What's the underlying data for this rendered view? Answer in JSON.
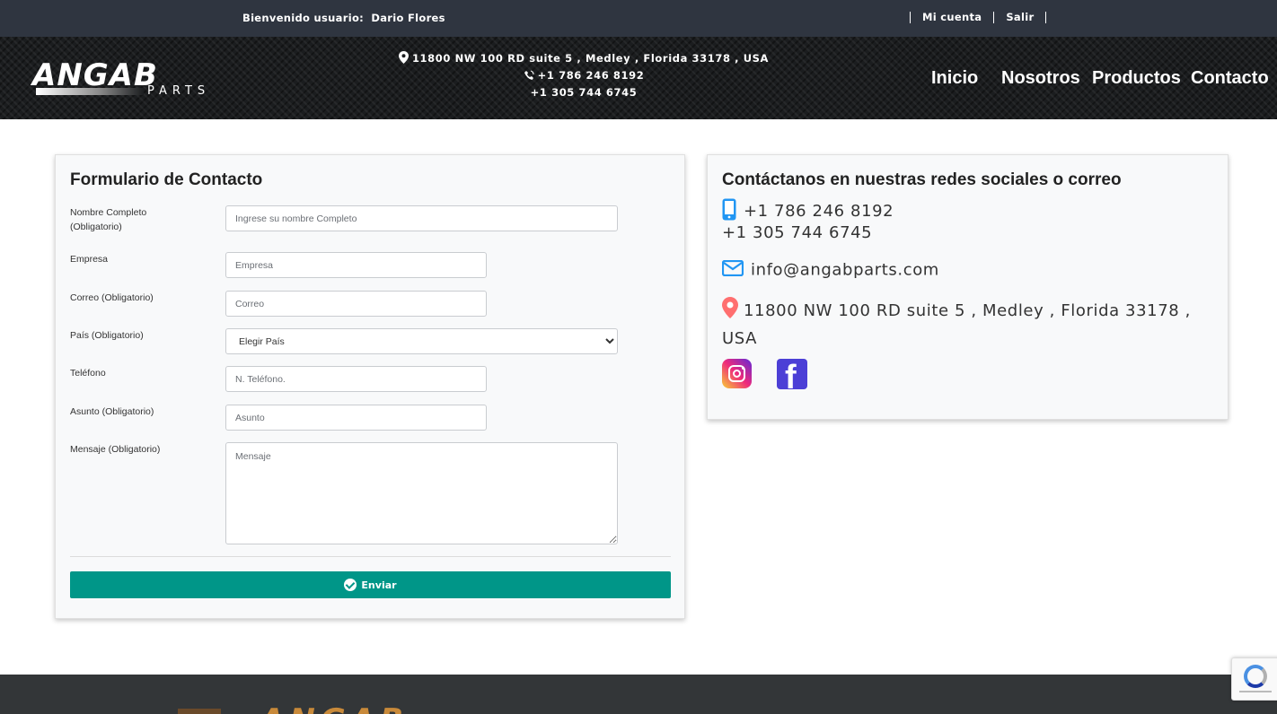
{
  "topbar": {
    "welcome_label": "Bienvenido usuario:",
    "user_name": "Dario Flores",
    "my_account": "Mi cuenta",
    "logout": "Salir"
  },
  "brand": {
    "logo_main": "ANGAB",
    "logo_sub": "PARTS"
  },
  "header_contact": {
    "address": "11800 NW 100 RD suite 5 , Medley , Florida 33178 , USA",
    "phone1": "+1 786 246 8192",
    "phone2": "+1 305 744 6745"
  },
  "nav": {
    "items": [
      "Inicio",
      "Nosotros",
      "Productos",
      "Contacto"
    ]
  },
  "form": {
    "title": "Formulario de Contacto",
    "fields": {
      "name_label": "Nombre Completo (Obligatorio)",
      "name_placeholder": "Ingrese su nombre Completo",
      "company_label": "Empresa",
      "company_placeholder": "Empresa",
      "email_label": "Correo (Obligatorio)",
      "email_placeholder": "Correo",
      "country_label": "País (Obligatorio)",
      "country_selected": "Elegir País",
      "phone_label": "Teléfono",
      "phone_placeholder": "N. Teléfono.",
      "subject_label": "Asunto (Obligatorio)",
      "subject_placeholder": "Asunto",
      "message_label": "Mensaje (Obligatorio)",
      "message_placeholder": "Mensaje"
    },
    "submit_label": "Enviar"
  },
  "social": {
    "title": "Contáctanos en nuestras redes sociales o correo",
    "phone1": "+1 786 246 8192",
    "phone2": "+1 305 744 6745",
    "email": "info@angabparts.com",
    "address": "11800 NW 100 RD suite 5 , Medley , Florida 33178 , USA",
    "icons": [
      "instagram-icon",
      "facebook-icon"
    ]
  },
  "footer": {
    "logo_main": "ANGAB"
  },
  "colors": {
    "topbar_bg": "#2f3540",
    "accent": "#009688",
    "phone_icon": "#2196f3",
    "email_icon": "#2196f3",
    "location_icon": "#ff6f6f",
    "facebook": "#4c3fd6"
  }
}
